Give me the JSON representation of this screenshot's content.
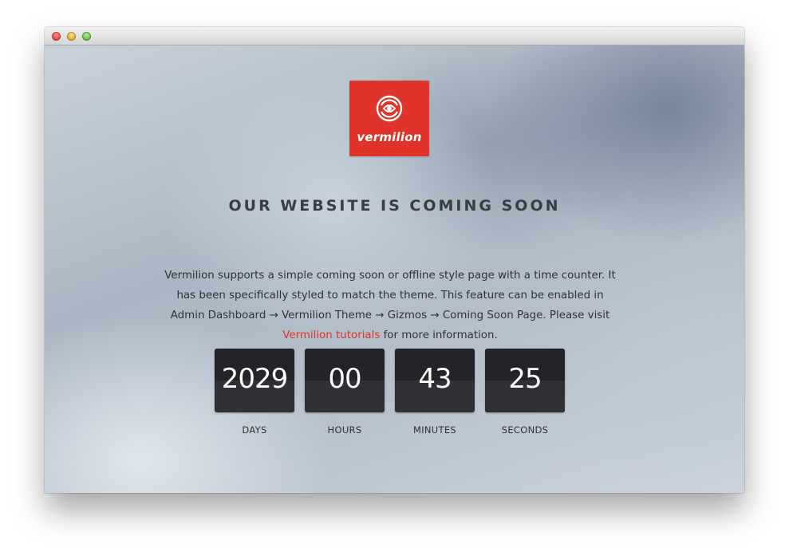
{
  "window": {
    "title": ""
  },
  "logo": {
    "text": "vermilion",
    "icon": "vermilion-emblem-icon",
    "color": "#e0332a"
  },
  "headline": "OUR WEBSITE IS COMING SOON",
  "description": {
    "text": "Vermilion supports a simple coming soon or offline style page with a time counter. It has been specifically styled to match the theme. This feature can be enabled in Admin Dashboard → Vermilion Theme → Gizmos → Coming Soon Page. Please visit ",
    "link_text": "Vermilion tutorials",
    "suffix": " for more information."
  },
  "countdown": [
    {
      "value": "2029",
      "label": "DAYS"
    },
    {
      "value": "00",
      "label": "HOURS"
    },
    {
      "value": "43",
      "label": "MINUTES"
    },
    {
      "value": "25",
      "label": "SECONDS"
    }
  ],
  "colors": {
    "accent": "#e0332a",
    "counter_bg": "#2f3135"
  }
}
